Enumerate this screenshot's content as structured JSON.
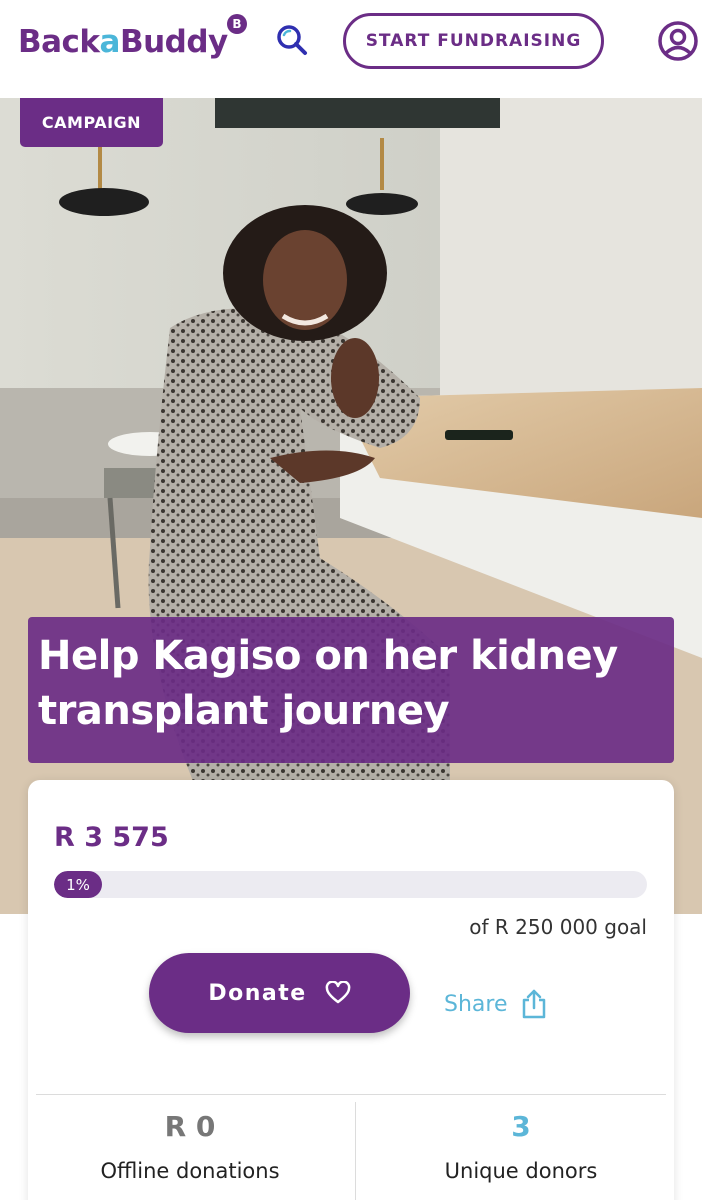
{
  "header": {
    "logo": {
      "part1": "Back",
      "part2": "a",
      "part3": "Buddy",
      "badge": "B"
    },
    "start_label": "START FUNDRAISING",
    "search_icon": "search-icon",
    "profile_icon": "user-circle-icon"
  },
  "campaign": {
    "tag": "CAMPAIGN",
    "title": "Help Kagiso on her kidney transplant journey"
  },
  "progress": {
    "raised": "R 3 575",
    "percent_label": "1%",
    "fraction": 0.01,
    "goal": "of R 250 000 goal"
  },
  "actions": {
    "donate_label": "Donate",
    "share_label": "Share"
  },
  "stats": {
    "offline_value": "R 0",
    "offline_label": "Offline donations",
    "donors_value": "3",
    "donors_label": "Unique donors"
  },
  "colors": {
    "brand_purple": "#6b2d86",
    "accent_blue": "#5cb6d8"
  }
}
